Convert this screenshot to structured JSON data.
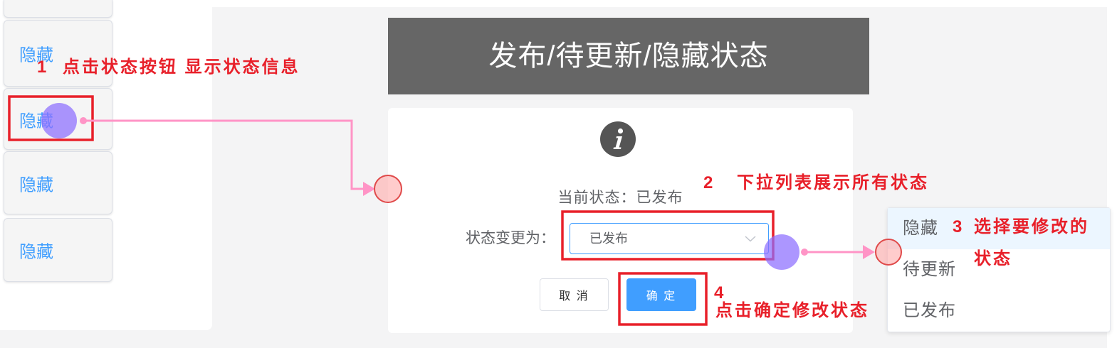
{
  "sidebar": {
    "items": [
      {
        "label": "隐藏"
      },
      {
        "label": "隐藏"
      },
      {
        "label": "隐藏"
      },
      {
        "label": "隐藏"
      }
    ]
  },
  "dialog": {
    "title": "发布/待更新/隐藏状态",
    "icon": "info-icon",
    "current_status_label": "当前状态：",
    "current_status_value": "已发布",
    "change_label": "状态变更为：",
    "select": {
      "value": "已发布",
      "icon": "chevron-down-icon"
    },
    "cancel_label": "取 消",
    "confirm_label": "确 定"
  },
  "dropdown": {
    "options": [
      {
        "label": "隐藏",
        "highlighted": true
      },
      {
        "label": "待更新",
        "highlighted": false
      },
      {
        "label": "已发布",
        "highlighted": false
      }
    ]
  },
  "annotations": {
    "step1": {
      "num": "1",
      "text": "点击状态按钮 显示状态信息"
    },
    "step2": {
      "num": "2",
      "text": "下拉列表展示所有状态"
    },
    "step3": {
      "num": "3",
      "line1": "选择要修改的",
      "line2": "状态"
    },
    "step4": {
      "num": "4",
      "text": "点击确定修改状态"
    }
  },
  "colors": {
    "accent": "#409eff",
    "annotation_red": "#e8202a",
    "header_bg": "#666666",
    "connector_pink": "#ff94c6",
    "highlight_row": "#ecf6ff"
  }
}
